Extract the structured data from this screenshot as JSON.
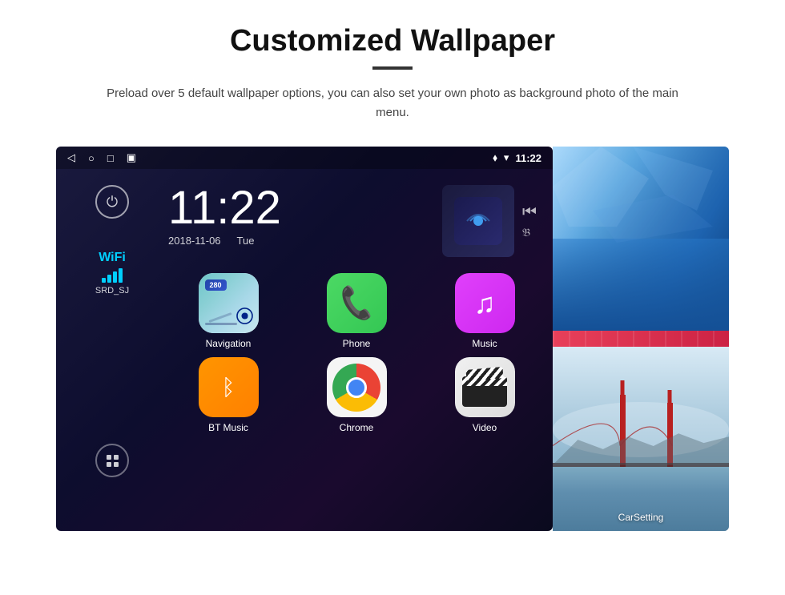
{
  "page": {
    "title": "Customized Wallpaper",
    "divider": "—",
    "description": "Preload over 5 default wallpaper options, you can also set your own photo as background photo of the main menu."
  },
  "android": {
    "status_bar": {
      "back_icon": "◁",
      "home_icon": "○",
      "recent_icon": "□",
      "screenshot_icon": "▣",
      "location_icon": "⬧",
      "wifi_icon": "▾",
      "time": "11:22"
    },
    "clock": {
      "time": "11:22",
      "date": "2018-11-06",
      "day": "Tue"
    },
    "wifi": {
      "label": "WiFi",
      "network": "SRD_SJ"
    },
    "apps": [
      {
        "id": "navigation",
        "label": "Navigation",
        "type": "navigation"
      },
      {
        "id": "phone",
        "label": "Phone",
        "type": "phone"
      },
      {
        "id": "music",
        "label": "Music",
        "type": "music"
      },
      {
        "id": "bt-music",
        "label": "BT Music",
        "type": "bt"
      },
      {
        "id": "chrome",
        "label": "Chrome",
        "type": "chrome"
      },
      {
        "id": "video",
        "label": "Video",
        "type": "video"
      }
    ],
    "car_setting_label": "CarSetting",
    "nav_badge": "280"
  }
}
